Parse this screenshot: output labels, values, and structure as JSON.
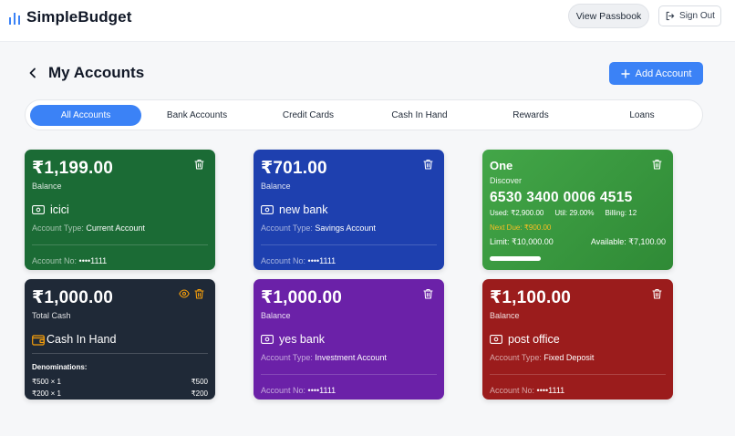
{
  "header": {
    "app_name": "SimpleBudget",
    "view_passbook": "View Passbook",
    "sign_out": "Sign Out"
  },
  "page": {
    "title": "My Accounts",
    "add_account": "Add Account"
  },
  "tabs": [
    {
      "label": "All Accounts",
      "active": true
    },
    {
      "label": "Bank Accounts",
      "active": false
    },
    {
      "label": "Credit Cards",
      "active": false
    },
    {
      "label": "Cash In Hand",
      "active": false
    },
    {
      "label": "Rewards",
      "active": false
    },
    {
      "label": "Loans",
      "active": false
    }
  ],
  "cards": {
    "icici": {
      "balance": "₹1,199.00",
      "balance_label": "Balance",
      "name": "icici",
      "type_key": "Account Type:",
      "type_value": "Current Account",
      "no_key": "Account No:",
      "no_value": "••••1111",
      "color": "#1b6b35"
    },
    "newbank": {
      "balance": "₹701.00",
      "balance_label": "Balance",
      "name": "new bank",
      "type_key": "Account Type:",
      "type_value": "Savings Account",
      "no_key": "Account No:",
      "no_value": "••••1111",
      "color": "#1e40af"
    },
    "credit": {
      "title": "One",
      "issuer": "Discover",
      "number": "6530 3400 0006 4515",
      "used": "Used: ₹2,900.00",
      "util": "Util: 29.00%",
      "billing": "Billing: 12",
      "next_due": "Next Due: ₹900.00",
      "limit": "Limit: ₹10,000.00",
      "available": "Available: ₹7,100.00",
      "utilization": 0.29,
      "color": "#3b9b40"
    },
    "cash": {
      "balance": "₹1,000.00",
      "balance_label": "Total Cash",
      "name": "Cash In Hand",
      "denom_title": "Denominations:",
      "denoms": [
        {
          "label": "₹500 × 1",
          "total": "₹500"
        },
        {
          "label": "₹200 × 1",
          "total": "₹200"
        }
      ],
      "color": "#1f2937",
      "accent": "#f59e0b"
    },
    "yesbank": {
      "balance": "₹1,000.00",
      "balance_label": "Balance",
      "name": "yes bank",
      "type_key": "Account Type:",
      "type_value": "Investment Account",
      "no_key": "Account No:",
      "no_value": "••••1111",
      "color": "#6b21a8"
    },
    "postoffice": {
      "balance": "₹1,100.00",
      "balance_label": "Balance",
      "name": "post office",
      "type_key": "Account Type:",
      "type_value": "Fixed Deposit",
      "no_key": "Account No:",
      "no_value": "••••1111",
      "color": "#9b1c1c"
    }
  },
  "colors": {
    "primary": "#3b82f6",
    "background": "#f6f7f9"
  },
  "icons": {
    "logo": "bar-chart-icon",
    "back": "chevron-left-icon",
    "add": "plus-icon",
    "signout": "log-out-icon",
    "delete": "trash-icon",
    "bank": "banknote-icon",
    "cash": "wallet-icon",
    "visibility": "eye-icon"
  }
}
